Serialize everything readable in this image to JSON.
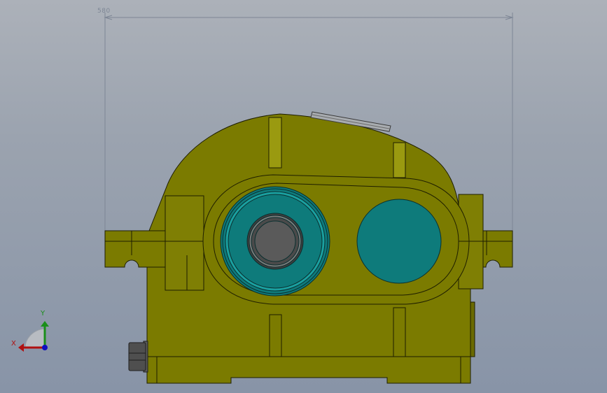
{
  "viewport": {
    "background_top": "#acb1b9",
    "background_bottom": "#8894a7"
  },
  "dimension": {
    "text": "580"
  },
  "model": {
    "body_color": "#7b7b00",
    "edge_color": "#1e1e00",
    "bearing_cap_color": "#0e7b7b",
    "shaft_color": "#5a5a5a"
  },
  "triad": {
    "x_label": "X",
    "y_label": "Y",
    "x_color": "#b01010",
    "y_color": "#1a8f1a",
    "z_color": "#1010c0"
  }
}
